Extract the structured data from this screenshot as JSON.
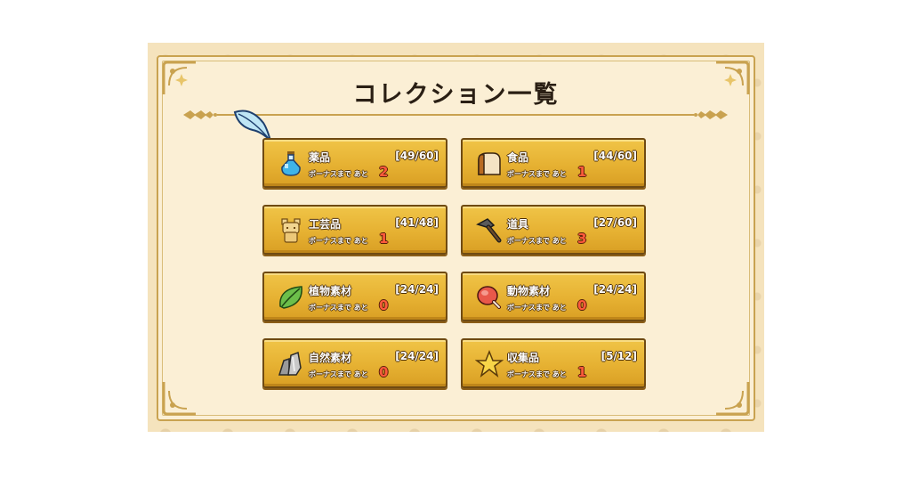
{
  "title": "コレクション一覧",
  "bonus_label": "ボーナスまで あと",
  "colors": {
    "remain": "#ff5a3c",
    "card": "#e6b132",
    "panel": "#f5e3bd"
  },
  "categories": [
    {
      "name": "薬品",
      "count": "[49/60]",
      "remain": "2",
      "icon": "potion-icon"
    },
    {
      "name": "食品",
      "count": "[44/60]",
      "remain": "1",
      "icon": "bread-icon"
    },
    {
      "name": "工芸品",
      "count": "[41/48]",
      "remain": "1",
      "icon": "figurine-icon"
    },
    {
      "name": "道具",
      "count": "[27/60]",
      "remain": "3",
      "icon": "hammer-icon"
    },
    {
      "name": "植物素材",
      "count": "[24/24]",
      "remain": "0",
      "icon": "leaf-icon"
    },
    {
      "name": "動物素材",
      "count": "[24/24]",
      "remain": "0",
      "icon": "meat-icon"
    },
    {
      "name": "自然素材",
      "count": "[24/24]",
      "remain": "0",
      "icon": "stone-icon"
    },
    {
      "name": "収集品",
      "count": "[5/12]",
      "remain": "1",
      "icon": "star-icon"
    }
  ]
}
